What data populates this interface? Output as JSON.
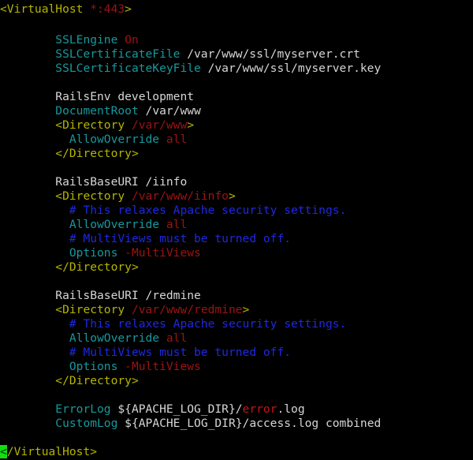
{
  "window": {
    "title": "Apache VirtualHost configuration",
    "background_color": "#000000",
    "font_family": "monospace"
  },
  "colors": {
    "plain": "#d6d6d6",
    "tag": "#b5b500",
    "attribute": "#17999c",
    "value": "#9e1313",
    "value_bright": "#c41616",
    "comment": "#1f28e0",
    "cursor_background": "#10e010",
    "cursor_foreground": "#063206"
  },
  "code": {
    "language": "apache-config",
    "lines": [
      {
        "id": "line-1",
        "tokens": [
          {
            "text": "<VirtualHost ",
            "type": "tag"
          },
          {
            "text": "*:443",
            "type": "value"
          },
          {
            "text": ">",
            "type": "tag"
          }
        ]
      },
      {
        "id": "line-2",
        "tokens": []
      },
      {
        "id": "line-3",
        "tokens": [
          {
            "text": "        ",
            "type": "plain"
          },
          {
            "text": "SSLEngine ",
            "type": "attribute"
          },
          {
            "text": "On",
            "type": "value"
          }
        ]
      },
      {
        "id": "line-4",
        "tokens": [
          {
            "text": "        ",
            "type": "plain"
          },
          {
            "text": "SSLCertificateFile ",
            "type": "attribute"
          },
          {
            "text": "/var/www/ssl/myserver.crt",
            "type": "plain"
          }
        ]
      },
      {
        "id": "line-5",
        "tokens": [
          {
            "text": "        ",
            "type": "plain"
          },
          {
            "text": "SSLCertificateKeyFile ",
            "type": "attribute"
          },
          {
            "text": "/var/www/ssl/myserver.key",
            "type": "plain"
          }
        ]
      },
      {
        "id": "line-6",
        "tokens": []
      },
      {
        "id": "line-7",
        "tokens": [
          {
            "text": "        RailsEnv development",
            "type": "plain"
          }
        ]
      },
      {
        "id": "line-8",
        "tokens": [
          {
            "text": "        ",
            "type": "plain"
          },
          {
            "text": "DocumentRoot ",
            "type": "attribute"
          },
          {
            "text": "/var/www",
            "type": "plain"
          }
        ]
      },
      {
        "id": "line-9",
        "tokens": [
          {
            "text": "        ",
            "type": "plain"
          },
          {
            "text": "<Directory ",
            "type": "tag"
          },
          {
            "text": "/var/www",
            "type": "value"
          },
          {
            "text": ">",
            "type": "tag"
          }
        ]
      },
      {
        "id": "line-10",
        "tokens": [
          {
            "text": "          ",
            "type": "plain"
          },
          {
            "text": "AllowOverride ",
            "type": "attribute"
          },
          {
            "text": "all",
            "type": "value"
          }
        ]
      },
      {
        "id": "line-11",
        "tokens": [
          {
            "text": "        ",
            "type": "plain"
          },
          {
            "text": "</Directory>",
            "type": "tag"
          }
        ]
      },
      {
        "id": "line-12",
        "tokens": []
      },
      {
        "id": "line-13",
        "tokens": [
          {
            "text": "        RailsBaseURI /iinfo",
            "type": "plain"
          }
        ]
      },
      {
        "id": "line-14",
        "tokens": [
          {
            "text": "        ",
            "type": "plain"
          },
          {
            "text": "<Directory ",
            "type": "tag"
          },
          {
            "text": "/var/www/iinfo",
            "type": "value"
          },
          {
            "text": ">",
            "type": "tag"
          }
        ]
      },
      {
        "id": "line-15",
        "tokens": [
          {
            "text": "          ",
            "type": "plain"
          },
          {
            "text": "# This relaxes Apache security settings.",
            "type": "comment"
          }
        ]
      },
      {
        "id": "line-16",
        "tokens": [
          {
            "text": "          ",
            "type": "plain"
          },
          {
            "text": "AllowOverride ",
            "type": "attribute"
          },
          {
            "text": "all",
            "type": "value"
          }
        ]
      },
      {
        "id": "line-17",
        "tokens": [
          {
            "text": "          ",
            "type": "plain"
          },
          {
            "text": "# MultiViews must be turned off.",
            "type": "comment"
          }
        ]
      },
      {
        "id": "line-18",
        "tokens": [
          {
            "text": "          ",
            "type": "plain"
          },
          {
            "text": "Options ",
            "type": "attribute"
          },
          {
            "text": "-MultiViews",
            "type": "value"
          }
        ]
      },
      {
        "id": "line-19",
        "tokens": [
          {
            "text": "        ",
            "type": "plain"
          },
          {
            "text": "</Directory>",
            "type": "tag"
          }
        ]
      },
      {
        "id": "line-20",
        "tokens": []
      },
      {
        "id": "line-21",
        "tokens": [
          {
            "text": "        RailsBaseURI /redmine",
            "type": "plain"
          }
        ]
      },
      {
        "id": "line-22",
        "tokens": [
          {
            "text": "        ",
            "type": "plain"
          },
          {
            "text": "<Directory ",
            "type": "tag"
          },
          {
            "text": "/var/www/redmine",
            "type": "value"
          },
          {
            "text": ">",
            "type": "tag"
          }
        ]
      },
      {
        "id": "line-23",
        "tokens": [
          {
            "text": "          ",
            "type": "plain"
          },
          {
            "text": "# This relaxes Apache security settings.",
            "type": "comment"
          }
        ]
      },
      {
        "id": "line-24",
        "tokens": [
          {
            "text": "          ",
            "type": "plain"
          },
          {
            "text": "AllowOverride ",
            "type": "attribute"
          },
          {
            "text": "all",
            "type": "value"
          }
        ]
      },
      {
        "id": "line-25",
        "tokens": [
          {
            "text": "          ",
            "type": "plain"
          },
          {
            "text": "# MultiViews must be turned off.",
            "type": "comment"
          }
        ]
      },
      {
        "id": "line-26",
        "tokens": [
          {
            "text": "          ",
            "type": "plain"
          },
          {
            "text": "Options ",
            "type": "attribute"
          },
          {
            "text": "-MultiViews",
            "type": "value"
          }
        ]
      },
      {
        "id": "line-27",
        "tokens": [
          {
            "text": "        ",
            "type": "plain"
          },
          {
            "text": "</Directory>",
            "type": "tag"
          }
        ]
      },
      {
        "id": "line-28",
        "tokens": []
      },
      {
        "id": "line-29",
        "tokens": [
          {
            "text": "        ",
            "type": "plain"
          },
          {
            "text": "ErrorLog ",
            "type": "attribute"
          },
          {
            "text": "${APACHE_LOG_DIR}/",
            "type": "plain"
          },
          {
            "text": "error",
            "type": "value_bright"
          },
          {
            "text": ".log",
            "type": "plain"
          }
        ]
      },
      {
        "id": "line-30",
        "tokens": [
          {
            "text": "        ",
            "type": "plain"
          },
          {
            "text": "CustomLog ",
            "type": "attribute"
          },
          {
            "text": "${APACHE_LOG_DIR}/access.log combined",
            "type": "plain"
          }
        ]
      },
      {
        "id": "line-31",
        "tokens": []
      },
      {
        "id": "line-32",
        "tokens": [
          {
            "text": "<",
            "type": "cursor"
          },
          {
            "text": "/VirtualHost>",
            "type": "tag"
          }
        ]
      }
    ]
  }
}
